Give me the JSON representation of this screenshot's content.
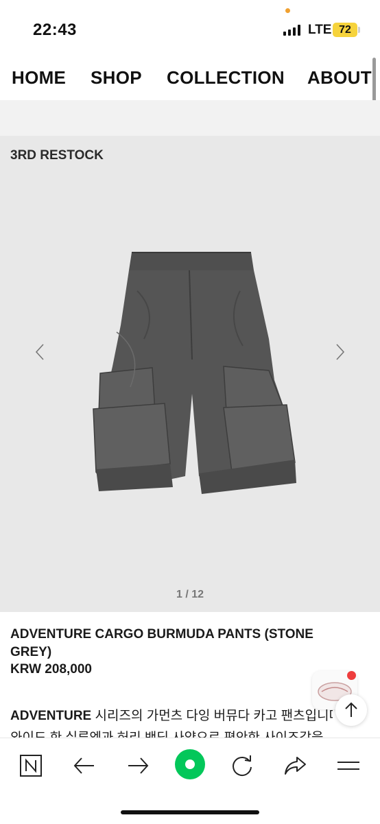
{
  "status_bar": {
    "time": "22:43",
    "network": "LTE",
    "battery": "72"
  },
  "nav": {
    "items": [
      {
        "label": "HOME"
      },
      {
        "label": "SHOP"
      },
      {
        "label": "COLLECTION"
      },
      {
        "label": "ABOUT"
      }
    ]
  },
  "gallery": {
    "label": "3RD RESTOCK",
    "counter": "1 / 12",
    "image_color": "#4a4a4a"
  },
  "product": {
    "title": "ADVENTURE CARGO BURMUDA PANTS (STONE GREY)",
    "price": "KRW 208,000",
    "desc_bold": "ADVENTURE",
    "desc_line1": " 시리즈의 가먼츠 다잉 버뮤다 카고 팬츠입니다.",
    "desc_line2": "와이드 한 실루엣과 허리 밴딩 사양으로 편안한 사이즈감을"
  },
  "browser_toolbar": {
    "icons": [
      "naver-n-icon",
      "back-arrow-icon",
      "forward-arrow-icon",
      "green-home-icon",
      "refresh-icon",
      "share-icon",
      "menu-icon"
    ],
    "accent": "#03c75a"
  },
  "colors": {
    "gallery_bg": "#e8e8e8",
    "battery": "#f6d33c",
    "notification": "#ee3d3d"
  }
}
